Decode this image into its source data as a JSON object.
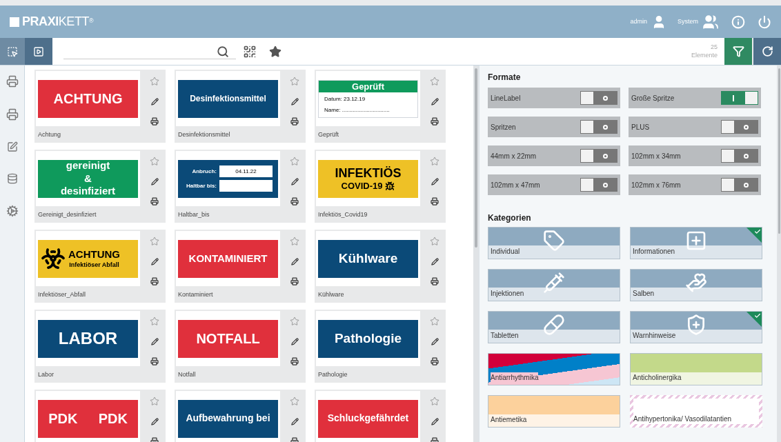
{
  "header": {
    "logo": "**PRAXI**KETT$^{®}$",
    "user": "admin",
    "system": "System"
  },
  "toolbar": {
    "count": "25",
    "count_label": "Elemente"
  },
  "labels": [
    {
      "name": "Achtung",
      "favorite": false,
      "preview": {
        "kind": "banner",
        "color": "#e0303c",
        "lines": [
          "ACHTUNG"
        ]
      }
    },
    {
      "name": "Desinfektionsmittel",
      "favorite": false,
      "preview": {
        "kind": "banner",
        "color": "#0b4a78",
        "lines": [
          "Desinfektionsmittel"
        ]
      }
    },
    {
      "name": "Geprüft",
      "favorite": false,
      "preview": {
        "kind": "checked",
        "color": "#0f9a5c",
        "title": "Geprüft",
        "fields": [
          "Datum: 23.12.19",
          "Name: ..............................."
        ]
      }
    },
    {
      "name": "Gereinigt_desinfiziert",
      "favorite": false,
      "preview": {
        "kind": "banner",
        "color": "#0f9a5c",
        "lines": [
          "gereinigt",
          "&",
          "desinfiziert"
        ]
      }
    },
    {
      "name": "Haltbar_bis",
      "favorite": false,
      "preview": {
        "kind": "form",
        "color": "#0b4a78",
        "fields": [
          {
            "label": "Anbruch:",
            "value": "04.11.22"
          },
          {
            "label": "Haltbar bis:"
          }
        ]
      }
    },
    {
      "name": "Infektiös_Covid19",
      "favorite": false,
      "preview": {
        "kind": "covid",
        "color": "#eec126",
        "lines": [
          "INFEKTIÖS",
          "COVID-19"
        ]
      }
    },
    {
      "name": "Infektiöser_Abfall",
      "favorite": false,
      "preview": {
        "kind": "biohazard",
        "color": "#eec126",
        "lines": [
          "ACHTUNG",
          "Infektiöser Abfall"
        ]
      }
    },
    {
      "name": "Kontaminiert",
      "favorite": false,
      "preview": {
        "kind": "banner",
        "color": "#e0303c",
        "lines": [
          "KONTAMINIERT"
        ]
      }
    },
    {
      "name": "Kühlware",
      "favorite": false,
      "preview": {
        "kind": "banner",
        "color": "#0b4a78",
        "lines": [
          "Kühlware"
        ]
      }
    },
    {
      "name": "Labor",
      "favorite": false,
      "preview": {
        "kind": "banner",
        "color": "#0b4a78",
        "lines": [
          "LABOR"
        ]
      }
    },
    {
      "name": "Notfall",
      "favorite": false,
      "preview": {
        "kind": "banner",
        "color": "#e0303c",
        "lines": [
          "NOTFALL"
        ]
      }
    },
    {
      "name": "Pathologie",
      "favorite": false,
      "preview": {
        "kind": "banner",
        "color": "#0b4a78",
        "lines": [
          "Pathologie"
        ]
      }
    },
    {
      "favorite": false,
      "preview": {
        "kind": "pair",
        "color": "#e0303c",
        "lines": [
          "PDK",
          "PDK"
        ]
      }
    },
    {
      "favorite": false,
      "preview": {
        "kind": "banner",
        "color": "#0b4a78",
        "lines": [
          "Aufbewahrung bei"
        ]
      }
    },
    {
      "favorite": false,
      "preview": {
        "kind": "banner",
        "color": "#e0303c",
        "lines": [
          "Schluckgefährdet"
        ]
      }
    }
  ],
  "formate": {
    "title": "Formate",
    "toggles": [
      {
        "label": "LineLabel",
        "on": false
      },
      {
        "label": "Große Spritze",
        "on": true
      },
      {
        "label": "Spritzen",
        "on": false
      },
      {
        "label": "PLUS",
        "on": false
      },
      {
        "label": "44mm x 22mm",
        "on": false
      },
      {
        "label": "102mm x 34mm",
        "on": false
      },
      {
        "label": "102mm x 47mm",
        "on": false
      },
      {
        "label": "102mm x 76mm",
        "on": false
      }
    ]
  },
  "kategorien": {
    "title": "Kategorien",
    "items": [
      {
        "label": "Individual",
        "kind": "icon",
        "checked": false
      },
      {
        "label": "Informationen",
        "kind": "icon",
        "checked": true
      },
      {
        "label": "Injektionen",
        "kind": "icon",
        "checked": false
      },
      {
        "label": "Salben",
        "kind": "icon",
        "checked": false
      },
      {
        "label": "Tabletten",
        "kind": "icon",
        "checked": false
      },
      {
        "label": "Warnhinweise",
        "kind": "icon",
        "checked": true
      },
      {
        "label": "Antiarrhythmika",
        "kind": "split"
      },
      {
        "label": "Anticholinergika",
        "kind": "color",
        "color": "#c3d98a"
      },
      {
        "label": "Antiemetika",
        "kind": "color",
        "color": "#fcd19c"
      },
      {
        "label": "Antihypertonika/ Vasodilatantien",
        "kind": "striped"
      }
    ]
  }
}
